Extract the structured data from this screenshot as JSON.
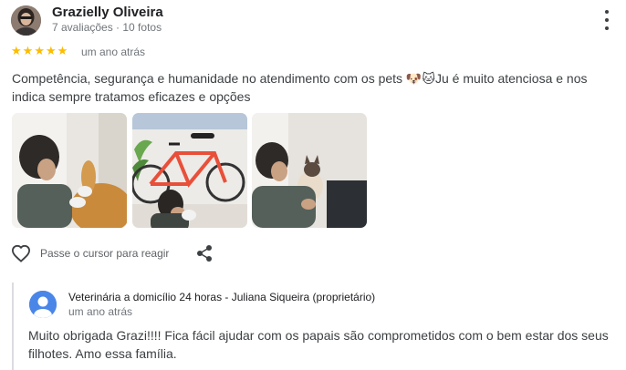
{
  "review": {
    "reviewer_name": "Grazielly Oliveira",
    "reviewer_meta": "7 avaliações · 10 fotos",
    "rating": 5,
    "date": "um ano atrás",
    "text": "Competência, segurança e humanidade no atendimento com os pets 🐶🐱Ju é muito atenciosa e nos indica sempre tratamos eficazes e opções",
    "photos": [
      {
        "icon": "dog-photo"
      },
      {
        "icon": "bicycle-photo"
      },
      {
        "icon": "cat-photo"
      }
    ],
    "react_label": "Passe o cursor para reagir",
    "icons": {
      "more": "more-vert-icon",
      "react": "heart-outline-icon",
      "share": "share-icon"
    }
  },
  "reply": {
    "owner_name": "Veterinária a domicílio 24 horas - Juliana Siqueira (proprietário)",
    "date": "um ano atrás",
    "text": "Muito obrigada Grazi!!!! Fica fácil ajudar com os papais são comprometidos com o bem estar dos seus filhotes. Amo essa família.",
    "avatar_icon": "person-icon"
  },
  "colors": {
    "star": "#fbbc04",
    "meta_text": "#70757a",
    "owner_avatar": "#4a86e8",
    "reply_bar": "#dadce0"
  }
}
